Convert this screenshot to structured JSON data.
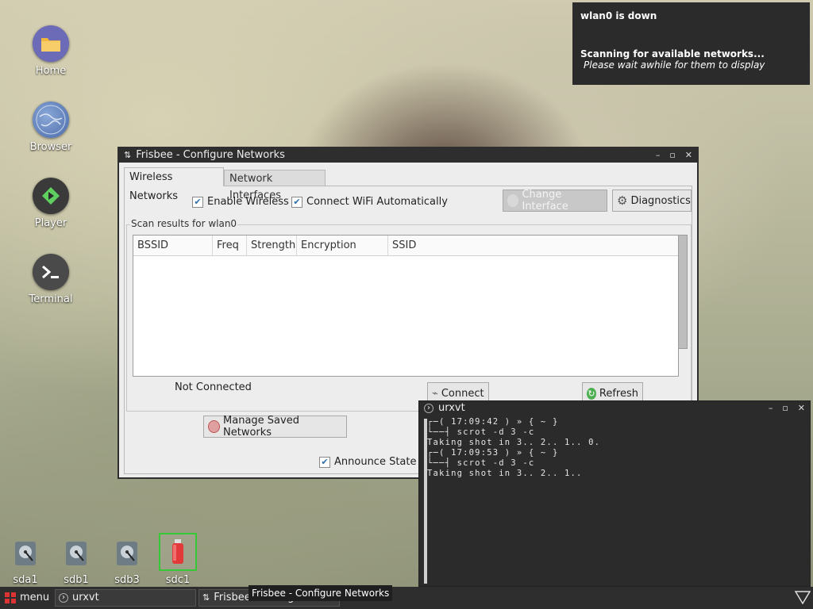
{
  "desktop": {
    "icons": [
      {
        "label": "Home",
        "icon": "folder-icon"
      },
      {
        "label": "Browser",
        "icon": "globe-icon"
      },
      {
        "label": "Player",
        "icon": "play-icon"
      },
      {
        "label": "Terminal",
        "icon": "terminal-icon"
      }
    ],
    "drives": [
      {
        "label": "sda1",
        "icon": "hard-drive-icon"
      },
      {
        "label": "sdb1",
        "icon": "hard-drive-icon"
      },
      {
        "label": "sdb3",
        "icon": "hard-drive-icon"
      },
      {
        "label": "sdc1",
        "icon": "usb-drive-icon"
      }
    ]
  },
  "notification": {
    "title": "wlan0 is down",
    "heading": "Scanning for available networks...",
    "body": "Please wait awhile for them to display"
  },
  "frisbee": {
    "title": "Frisbee - Configure Networks",
    "tabs": [
      "Wireless Networks",
      "Network Interfaces"
    ],
    "enable_wireless": "Enable Wireless",
    "connect_auto": "Connect WiFi Automatically",
    "change_interface": "Change Interface",
    "diagnostics": "Diagnostics",
    "scan_label": "Scan results for wlan0",
    "columns": [
      "BSSID",
      "Freq",
      "Strength",
      "Encryption",
      "SSID"
    ],
    "status": "Not Connected",
    "connect": "Connect",
    "refresh": "Refresh",
    "manage_saved": "Manage Saved Networks",
    "announce": "Announce State C"
  },
  "terminal": {
    "title": "urxvt",
    "lines": [
      "┌─( 17:09:42 ) » { ~ }",
      "└──┤ scrot -d 3 -c",
      "Taking shot in 3.. 2.. 1.. 0.",
      "┌─( 17:09:53 ) » { ~ }",
      "└──┤ scrot -d 3 -c",
      "Taking shot in 3.. 2.. 1.."
    ]
  },
  "taskbar": {
    "menu": "menu",
    "task1": "urxvt",
    "task2": "Frisbee - Configure Netw",
    "tooltip": "Frisbee - Configure Networks"
  },
  "colors": {
    "accent": "#2d6fae",
    "usb_highlight": "#37c837",
    "player_green": "#5fcf5f"
  }
}
